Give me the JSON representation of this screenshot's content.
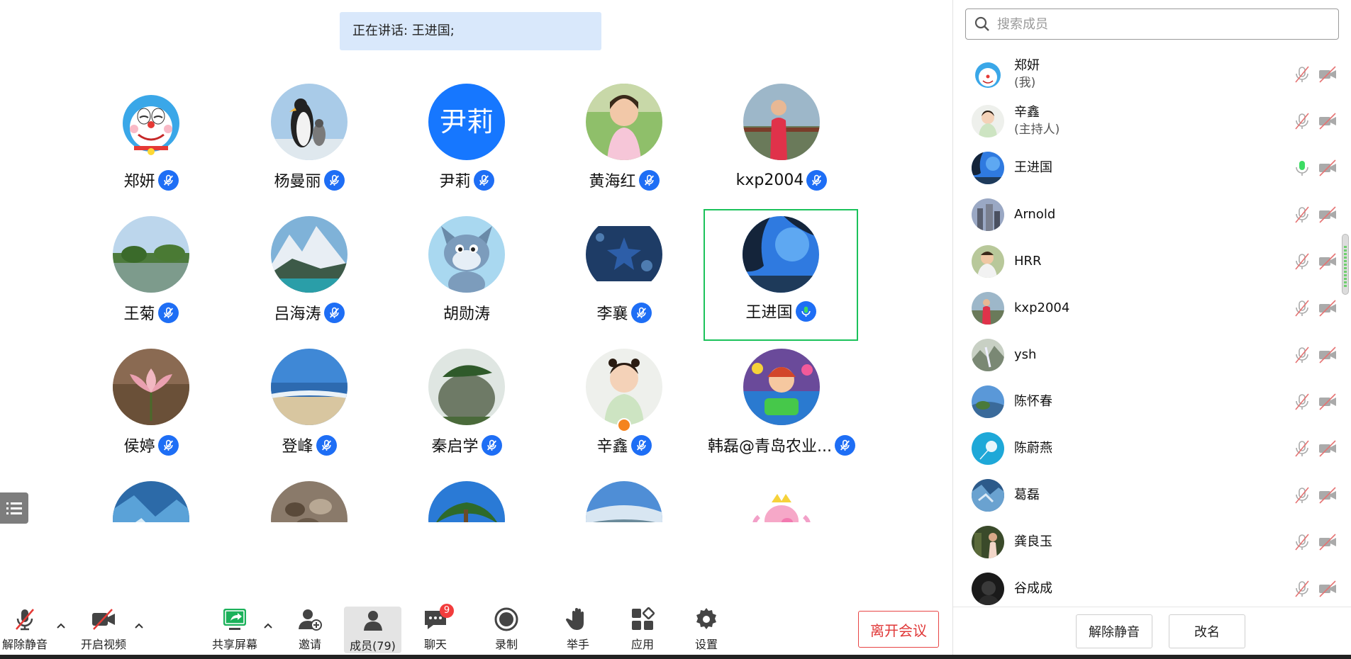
{
  "banner": {
    "speaking_text": "正在讲话: 王进国;"
  },
  "gallery": {
    "tiles": [
      {
        "name": "郑妍",
        "avatar": "doraemon"
      },
      {
        "name": "杨曼丽",
        "avatar": "penguins"
      },
      {
        "name": "尹莉",
        "avatar": "initials",
        "initials": "尹莉"
      },
      {
        "name": "黄海红",
        "avatar": "child-photo"
      },
      {
        "name": "kxp2004",
        "avatar": "boy-photo"
      },
      {
        "name": "王菊",
        "avatar": "lake"
      },
      {
        "name": "吕海涛",
        "avatar": "mountains"
      },
      {
        "name": "胡勋涛",
        "avatar": "tom-cat"
      },
      {
        "name": "李襄",
        "avatar": "starfish"
      },
      {
        "name": "王进国",
        "avatar": "sky-trees",
        "active": true
      },
      {
        "name": "侯婷",
        "avatar": "flower"
      },
      {
        "name": "登峰",
        "avatar": "beach"
      },
      {
        "name": "秦启学",
        "avatar": "rock"
      },
      {
        "name": "辛鑫",
        "avatar": "girl-photo",
        "host": true
      },
      {
        "name": "韩磊@青岛农业...",
        "avatar": "cartoon-game"
      }
    ]
  },
  "toolbar": {
    "unmute_label": "解除静音",
    "video_label": "开启视频",
    "share_label": "共享屏幕",
    "invite_label": "邀请",
    "members_label": "成员(79)",
    "chat_label": "聊天",
    "chat_badge": "9",
    "record_label": "录制",
    "raise_hand_label": "举手",
    "apps_label": "应用",
    "settings_label": "设置",
    "leave_label": "离开会议"
  },
  "panel": {
    "search_placeholder": "搜索成员",
    "members": [
      {
        "name": "郑妍",
        "role": "(我)",
        "avatar": "doraemon"
      },
      {
        "name": "辛鑫",
        "role": "(主持人)",
        "avatar": "girl-photo"
      },
      {
        "name": "王进国",
        "role": "",
        "avatar": "sky-trees",
        "mic_on": true
      },
      {
        "name": "Arnold",
        "role": "",
        "avatar": "city"
      },
      {
        "name": "HRR",
        "role": "",
        "avatar": "child2"
      },
      {
        "name": "kxp2004",
        "role": "",
        "avatar": "boy-photo"
      },
      {
        "name": "ysh",
        "role": "",
        "avatar": "landscape"
      },
      {
        "name": "陈怀春",
        "role": "",
        "avatar": "coast"
      },
      {
        "name": "陈蔚燕",
        "role": "",
        "avatar": "dandelion"
      },
      {
        "name": "葛磊",
        "role": "",
        "avatar": "blue-pattern"
      },
      {
        "name": "龚良玉",
        "role": "",
        "avatar": "portrait"
      },
      {
        "name": "谷成成",
        "role": "",
        "avatar": "dark"
      }
    ],
    "footer": {
      "unmute_all_label": "解除静音",
      "rename_label": "改名"
    }
  },
  "colors": {
    "accent": "#1e6ef5",
    "active_border": "#1bc25b",
    "leave": "#e03838",
    "banner_bg": "#d9e8fb"
  }
}
